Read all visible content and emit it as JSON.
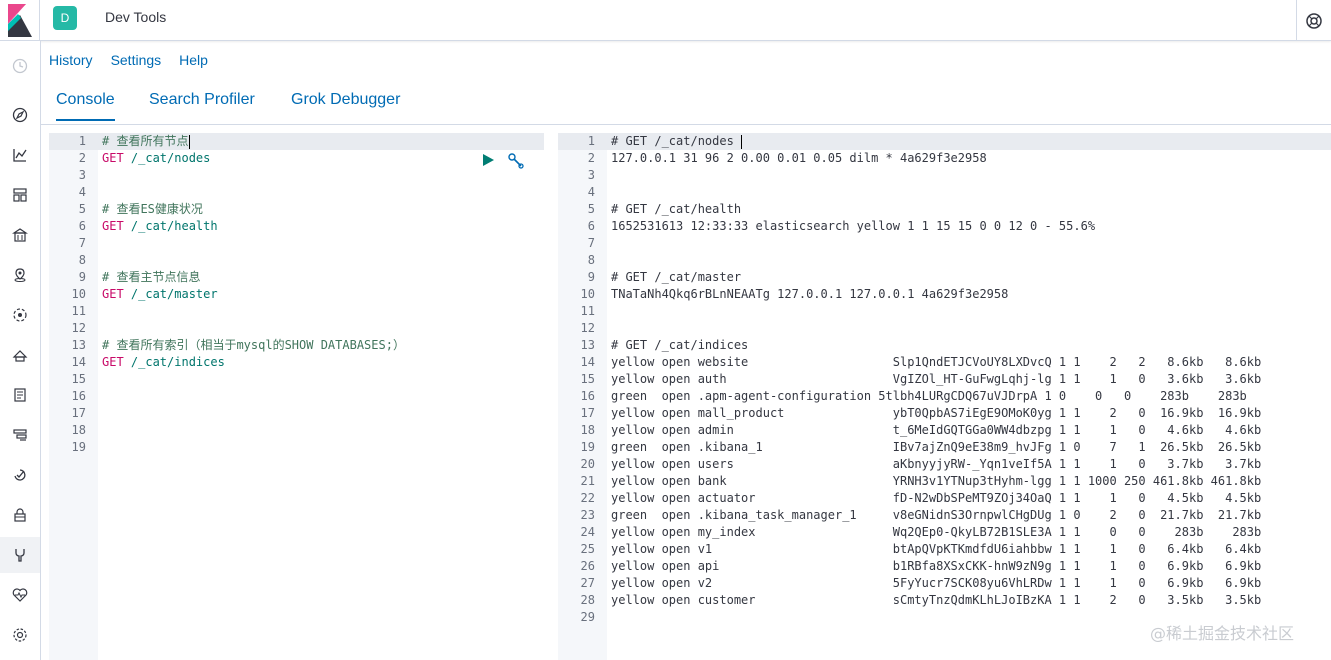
{
  "app": {
    "title": "Dev Tools",
    "space_initial": "D"
  },
  "menu": {
    "history": "History",
    "settings": "Settings",
    "help": "Help"
  },
  "tabs": [
    {
      "label": "Console",
      "active": true
    },
    {
      "label": "Search Profiler",
      "active": false
    },
    {
      "label": "Grok Debugger",
      "active": false
    }
  ],
  "editor": {
    "lines": [
      {
        "n": "1",
        "parts": [
          [
            "comment",
            "# 查看所有节点"
          ]
        ]
      },
      {
        "n": "2",
        "parts": [
          [
            "method",
            "GET "
          ],
          [
            "url",
            "/_cat/nodes"
          ]
        ]
      },
      {
        "n": "3",
        "parts": []
      },
      {
        "n": "4",
        "parts": []
      },
      {
        "n": "5",
        "parts": [
          [
            "comment",
            "# 查看ES健康状况"
          ]
        ]
      },
      {
        "n": "6",
        "parts": [
          [
            "method",
            "GET "
          ],
          [
            "url",
            "/_cat/health"
          ]
        ]
      },
      {
        "n": "7",
        "parts": []
      },
      {
        "n": "8",
        "parts": []
      },
      {
        "n": "9",
        "parts": [
          [
            "comment",
            "# 查看主节点信息"
          ]
        ]
      },
      {
        "n": "10",
        "parts": [
          [
            "method",
            "GET "
          ],
          [
            "url",
            "/_cat/master"
          ]
        ]
      },
      {
        "n": "11",
        "parts": []
      },
      {
        "n": "12",
        "parts": []
      },
      {
        "n": "13",
        "parts": [
          [
            "comment",
            "# 查看所有索引（相当于mysql的SHOW DATABASES;）"
          ]
        ]
      },
      {
        "n": "14",
        "parts": [
          [
            "method",
            "GET "
          ],
          [
            "url",
            "/_cat/indices"
          ]
        ]
      },
      {
        "n": "15",
        "parts": []
      },
      {
        "n": "16",
        "parts": []
      },
      {
        "n": "17",
        "parts": []
      },
      {
        "n": "18",
        "parts": []
      },
      {
        "n": "19",
        "parts": []
      }
    ]
  },
  "output": {
    "lines": [
      {
        "n": "1",
        "text": "# GET /_cat/nodes"
      },
      {
        "n": "2",
        "text": "127.0.0.1 31 96 2 0.00 0.01 0.05 dilm * 4a629f3e2958"
      },
      {
        "n": "3",
        "text": ""
      },
      {
        "n": "4",
        "text": ""
      },
      {
        "n": "5",
        "text": "# GET /_cat/health"
      },
      {
        "n": "6",
        "text": "1652531613 12:33:33 elasticsearch yellow 1 1 15 15 0 0 12 0 - 55.6%"
      },
      {
        "n": "7",
        "text": ""
      },
      {
        "n": "8",
        "text": ""
      },
      {
        "n": "9",
        "text": "# GET /_cat/master"
      },
      {
        "n": "10",
        "text": "TNaTaNh4Qkq6rBLnNEAATg 127.0.0.1 127.0.0.1 4a629f3e2958"
      },
      {
        "n": "11",
        "text": ""
      },
      {
        "n": "12",
        "text": ""
      },
      {
        "n": "13",
        "text": "# GET /_cat/indices"
      },
      {
        "n": "14",
        "text": "yellow open website                    Slp1QndETJCVoUY8LXDvcQ 1 1    2   2   8.6kb   8.6kb"
      },
      {
        "n": "15",
        "text": "yellow open auth                       VgIZOl_HT-GuFwgLqhj-lg 1 1    1   0   3.6kb   3.6kb"
      },
      {
        "n": "16",
        "text": "green  open .apm-agent-configuration 5tlbh4LURgCDQ67uVJDrpA 1 0    0   0    283b    283b"
      },
      {
        "n": "17",
        "text": "yellow open mall_product               ybT0QpbAS7iEgE9OMoK0yg 1 1    2   0  16.9kb  16.9kb"
      },
      {
        "n": "18",
        "text": "yellow open admin                      t_6MeIdGQTGGa0WW4dbzpg 1 1    1   0   4.6kb   4.6kb"
      },
      {
        "n": "19",
        "text": "green  open .kibana_1                  IBv7ajZnQ9eE38m9_hvJFg 1 0    7   1  26.5kb  26.5kb"
      },
      {
        "n": "20",
        "text": "yellow open users                      aKbnyyjyRW-_Yqn1veIf5A 1 1    1   0   3.7kb   3.7kb"
      },
      {
        "n": "21",
        "text": "yellow open bank                       YRNH3v1YTNup3tHyhm-lgg 1 1 1000 250 461.8kb 461.8kb"
      },
      {
        "n": "22",
        "text": "yellow open actuator                   fD-N2wDbSPeMT9ZOj34OaQ 1 1    1   0   4.5kb   4.5kb"
      },
      {
        "n": "23",
        "text": "green  open .kibana_task_manager_1     v8eGNidnS3OrnpwlCHgDUg 1 0    2   0  21.7kb  21.7kb"
      },
      {
        "n": "24",
        "text": "yellow open my_index                   Wq2QEp0-QkyLB72B1SLE3A 1 1    0   0    283b    283b"
      },
      {
        "n": "25",
        "text": "yellow open v1                         btApQVpKTKmdfdU6iahbbw 1 1    1   0   6.4kb   6.4kb"
      },
      {
        "n": "26",
        "text": "yellow open api                        b1RBfa8XSxCKK-hnW9zN9g 1 1    1   0   6.9kb   6.9kb"
      },
      {
        "n": "27",
        "text": "yellow open v2                         5FyYucr7SCK08yu6VhLRDw 1 1    1   0   6.9kb   6.9kb"
      },
      {
        "n": "28",
        "text": "yellow open customer                   sCmtyTnzQdmKLhLJoIBzKA 1 1    2   0   3.5kb   3.5kb"
      },
      {
        "n": "29",
        "text": ""
      }
    ]
  },
  "watermark": "@稀土掘金技术社区",
  "colors": {
    "accent": "#006bb4",
    "space": "#25b9a6",
    "play": "#017d73"
  }
}
